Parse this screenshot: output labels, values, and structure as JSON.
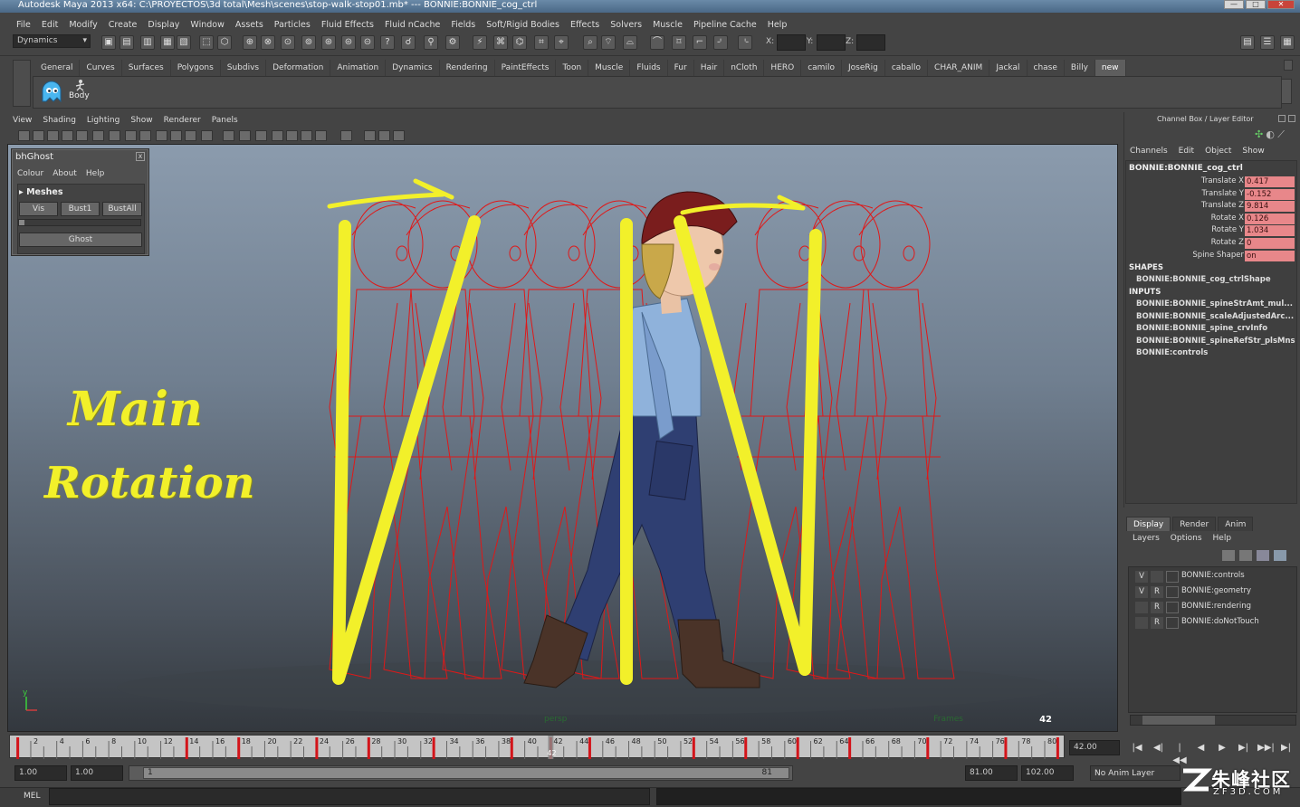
{
  "window": {
    "title": "Autodesk Maya 2013 x64: C:\\PROYECTOS\\3d total\\Mesh\\scenes\\stop-walk-stop01.mb*  ---  BONNIE:BONNIE_cog_ctrl",
    "buttons": [
      "—",
      "□",
      "✕"
    ]
  },
  "menubar": [
    "File",
    "Edit",
    "Modify",
    "Create",
    "Display",
    "Window",
    "Assets",
    "Particles",
    "Fluid Effects",
    "Fluid nCache",
    "Fields",
    "Soft/Rigid Bodies",
    "Effects",
    "Solvers",
    "Muscle",
    "Pipeline Cache",
    "Help"
  ],
  "statusline": {
    "mode": "Dynamics",
    "x_label": "X:",
    "y_label": "Y:",
    "z_label": "Z:"
  },
  "shelf": {
    "tabs": [
      "General",
      "Curves",
      "Surfaces",
      "Polygons",
      "Subdivs",
      "Deformation",
      "Animation",
      "Dynamics",
      "Rendering",
      "PaintEffects",
      "Toon",
      "Muscle",
      "Fluids",
      "Fur",
      "Hair",
      "nCloth",
      "HERO",
      "camilo",
      "JoseRig",
      "caballo",
      "CHAR_ANIM",
      "Jackal",
      "chase",
      "Billy",
      "new"
    ],
    "active_tab": "new",
    "button_label": "Body"
  },
  "viewport": {
    "menu": [
      "View",
      "Shading",
      "Lighting",
      "Show",
      "Renderer",
      "Panels"
    ],
    "frame_number": "42",
    "camera_label": "persp",
    "fps_label": "Frames",
    "axis_y": "y",
    "axis_x": "x",
    "annotation_line1": "Main",
    "annotation_line2": "Rotation",
    "annotation_color": "#f2f02a",
    "ghost_color": "#e01818"
  },
  "bhghost": {
    "title": "bhGhost",
    "close": "x",
    "menu": [
      "Colour",
      "About",
      "Help"
    ],
    "section": "Meshes",
    "buttons": [
      "Vis",
      "Bust1",
      "BustAll"
    ],
    "ghost_button": "Ghost"
  },
  "channelbox": {
    "title": "Channel Box / Layer Editor",
    "menu": [
      "Channels",
      "Edit",
      "Object",
      "Show"
    ],
    "node": "BONNIE:BONNIE_cog_ctrl",
    "channels": [
      {
        "label": "Translate X",
        "value": "0.417"
      },
      {
        "label": "Translate Y",
        "value": "-0.152"
      },
      {
        "label": "Translate Z",
        "value": "9.814"
      },
      {
        "label": "Rotate X",
        "value": "0.126"
      },
      {
        "label": "Rotate Y",
        "value": "1.034"
      },
      {
        "label": "Rotate Z",
        "value": "0"
      },
      {
        "label": "Spine Shaper",
        "value": "on"
      }
    ],
    "shapes_header": "SHAPES",
    "shapes": [
      "BONNIE:BONNIE_cog_ctrlShape"
    ],
    "inputs_header": "INPUTS",
    "inputs": [
      "BONNIE:BONNIE_spineStrAmt_mul...",
      "BONNIE:BONNIE_scaleAdjustedArc...",
      "BONNIE:BONNIE_spine_crvInfo",
      "BONNIE:BONNIE_spineRefStr_plsMns",
      "BONNIE:controls"
    ],
    "keyed_color": "#e8878a"
  },
  "layereditor": {
    "tabs": [
      "Display",
      "Render",
      "Anim"
    ],
    "active_tab": "Display",
    "menu": [
      "Layers",
      "Options",
      "Help"
    ],
    "layers": [
      {
        "v": "V",
        "r": "",
        "name": "BONNIE:controls"
      },
      {
        "v": "V",
        "r": "R",
        "name": "BONNIE:geometry"
      },
      {
        "v": "",
        "r": "R",
        "name": "BONNIE:rendering"
      },
      {
        "v": "",
        "r": "R",
        "name": "BONNIE:doNotTouch"
      }
    ]
  },
  "timeline": {
    "ticks": [
      "2",
      "4",
      "6",
      "8",
      "10",
      "12",
      "14",
      "16",
      "18",
      "20",
      "22",
      "24",
      "26",
      "28",
      "30",
      "32",
      "34",
      "36",
      "38",
      "40",
      "42",
      "44",
      "46",
      "48",
      "50",
      "52",
      "54",
      "56",
      "58",
      "60",
      "62",
      "64",
      "66",
      "68",
      "70",
      "72",
      "74",
      "76",
      "78",
      "80"
    ],
    "current_frame_label": "42",
    "current_frame": "42.00",
    "keys": [
      1,
      14,
      18,
      24,
      28,
      33,
      39,
      42,
      45,
      53,
      57,
      61,
      65,
      71,
      77,
      81
    ],
    "playback_buttons": [
      "|◀",
      "◀|",
      "|◀◀",
      "◀",
      "▶",
      "▶|",
      "▶▶|",
      "▶|"
    ]
  },
  "range": {
    "start": "1.00",
    "playback_start": "1.00",
    "inner_start": "1",
    "inner_end": "81",
    "playback_end": "81.00",
    "end": "102.00",
    "anim_layer": "No Anim Layer"
  },
  "commandline": {
    "label": "MEL"
  },
  "watermark": {
    "main": "朱峰社区",
    "sub": "ZF3D.COM"
  }
}
